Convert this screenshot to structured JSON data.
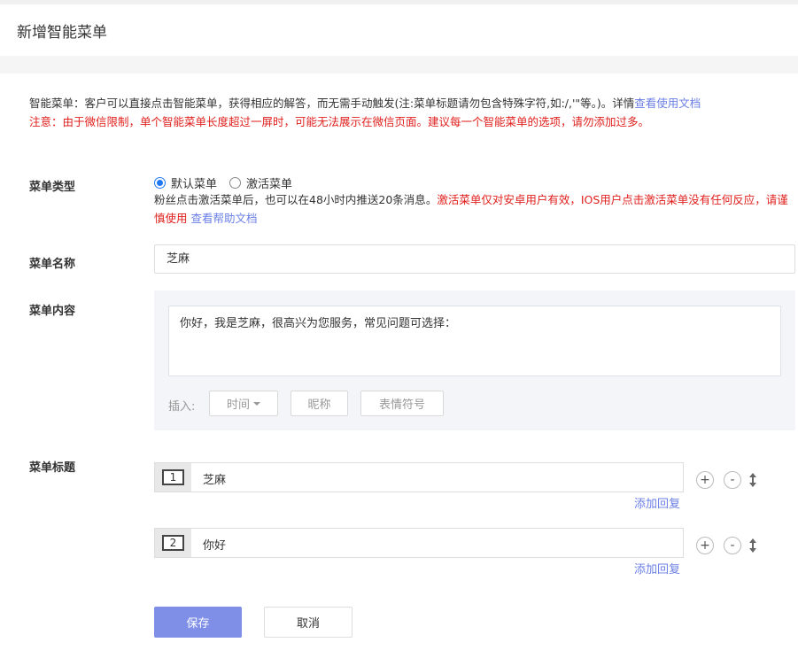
{
  "page": {
    "title": "新增智能菜单"
  },
  "info": {
    "line1_text": "智能菜单：客户可以直接点击智能菜单，获得相应的解答，而无需手动触发(注:菜单标题请勿包含特殊字符,如:/,'\"等。)。详情",
    "line1_link": "查看使用文档",
    "line2_text": "注意：由于微信限制，单个智能菜单长度超过一屏时，可能无法展示在微信页面。建议每一个智能菜单的选项，请勿添加过多。"
  },
  "menu_type": {
    "label": "菜单类型",
    "options": [
      {
        "label": "默认菜单",
        "selected": true
      },
      {
        "label": "激活菜单",
        "selected": false
      }
    ],
    "help_black": "粉丝点击激活菜单后，也可以在48小时内推送20条消息。",
    "help_red": "激活菜单仅对安卓用户有效，IOS用户点击激活菜单没有任何反应，请谨 慎使用",
    "help_link": "查看帮助文档"
  },
  "menu_name": {
    "label": "菜单名称",
    "value": "芝麻"
  },
  "menu_content": {
    "label": "菜单内容",
    "value": "你好，我是芝麻，很高兴为您服务，常见问题可选择：",
    "insert_label": "插入:",
    "insert_buttons": {
      "time": "时间",
      "nickname": "昵称",
      "emoji": "表情符号"
    }
  },
  "menu_titles": {
    "label": "菜单标题",
    "items": [
      {
        "number": "1",
        "text": "芝麻",
        "add_reply": "添加回复"
      },
      {
        "number": "2",
        "text": "你好",
        "add_reply": "添加回复"
      }
    ],
    "plus_glyph": "+",
    "minus_glyph": "-"
  },
  "actions": {
    "save": "保存",
    "cancel": "取消"
  },
  "colors": {
    "accent": "#7f8fe8",
    "link": "#6a7ee6",
    "warning": "#e0201d",
    "radio": "#1e78f5"
  }
}
